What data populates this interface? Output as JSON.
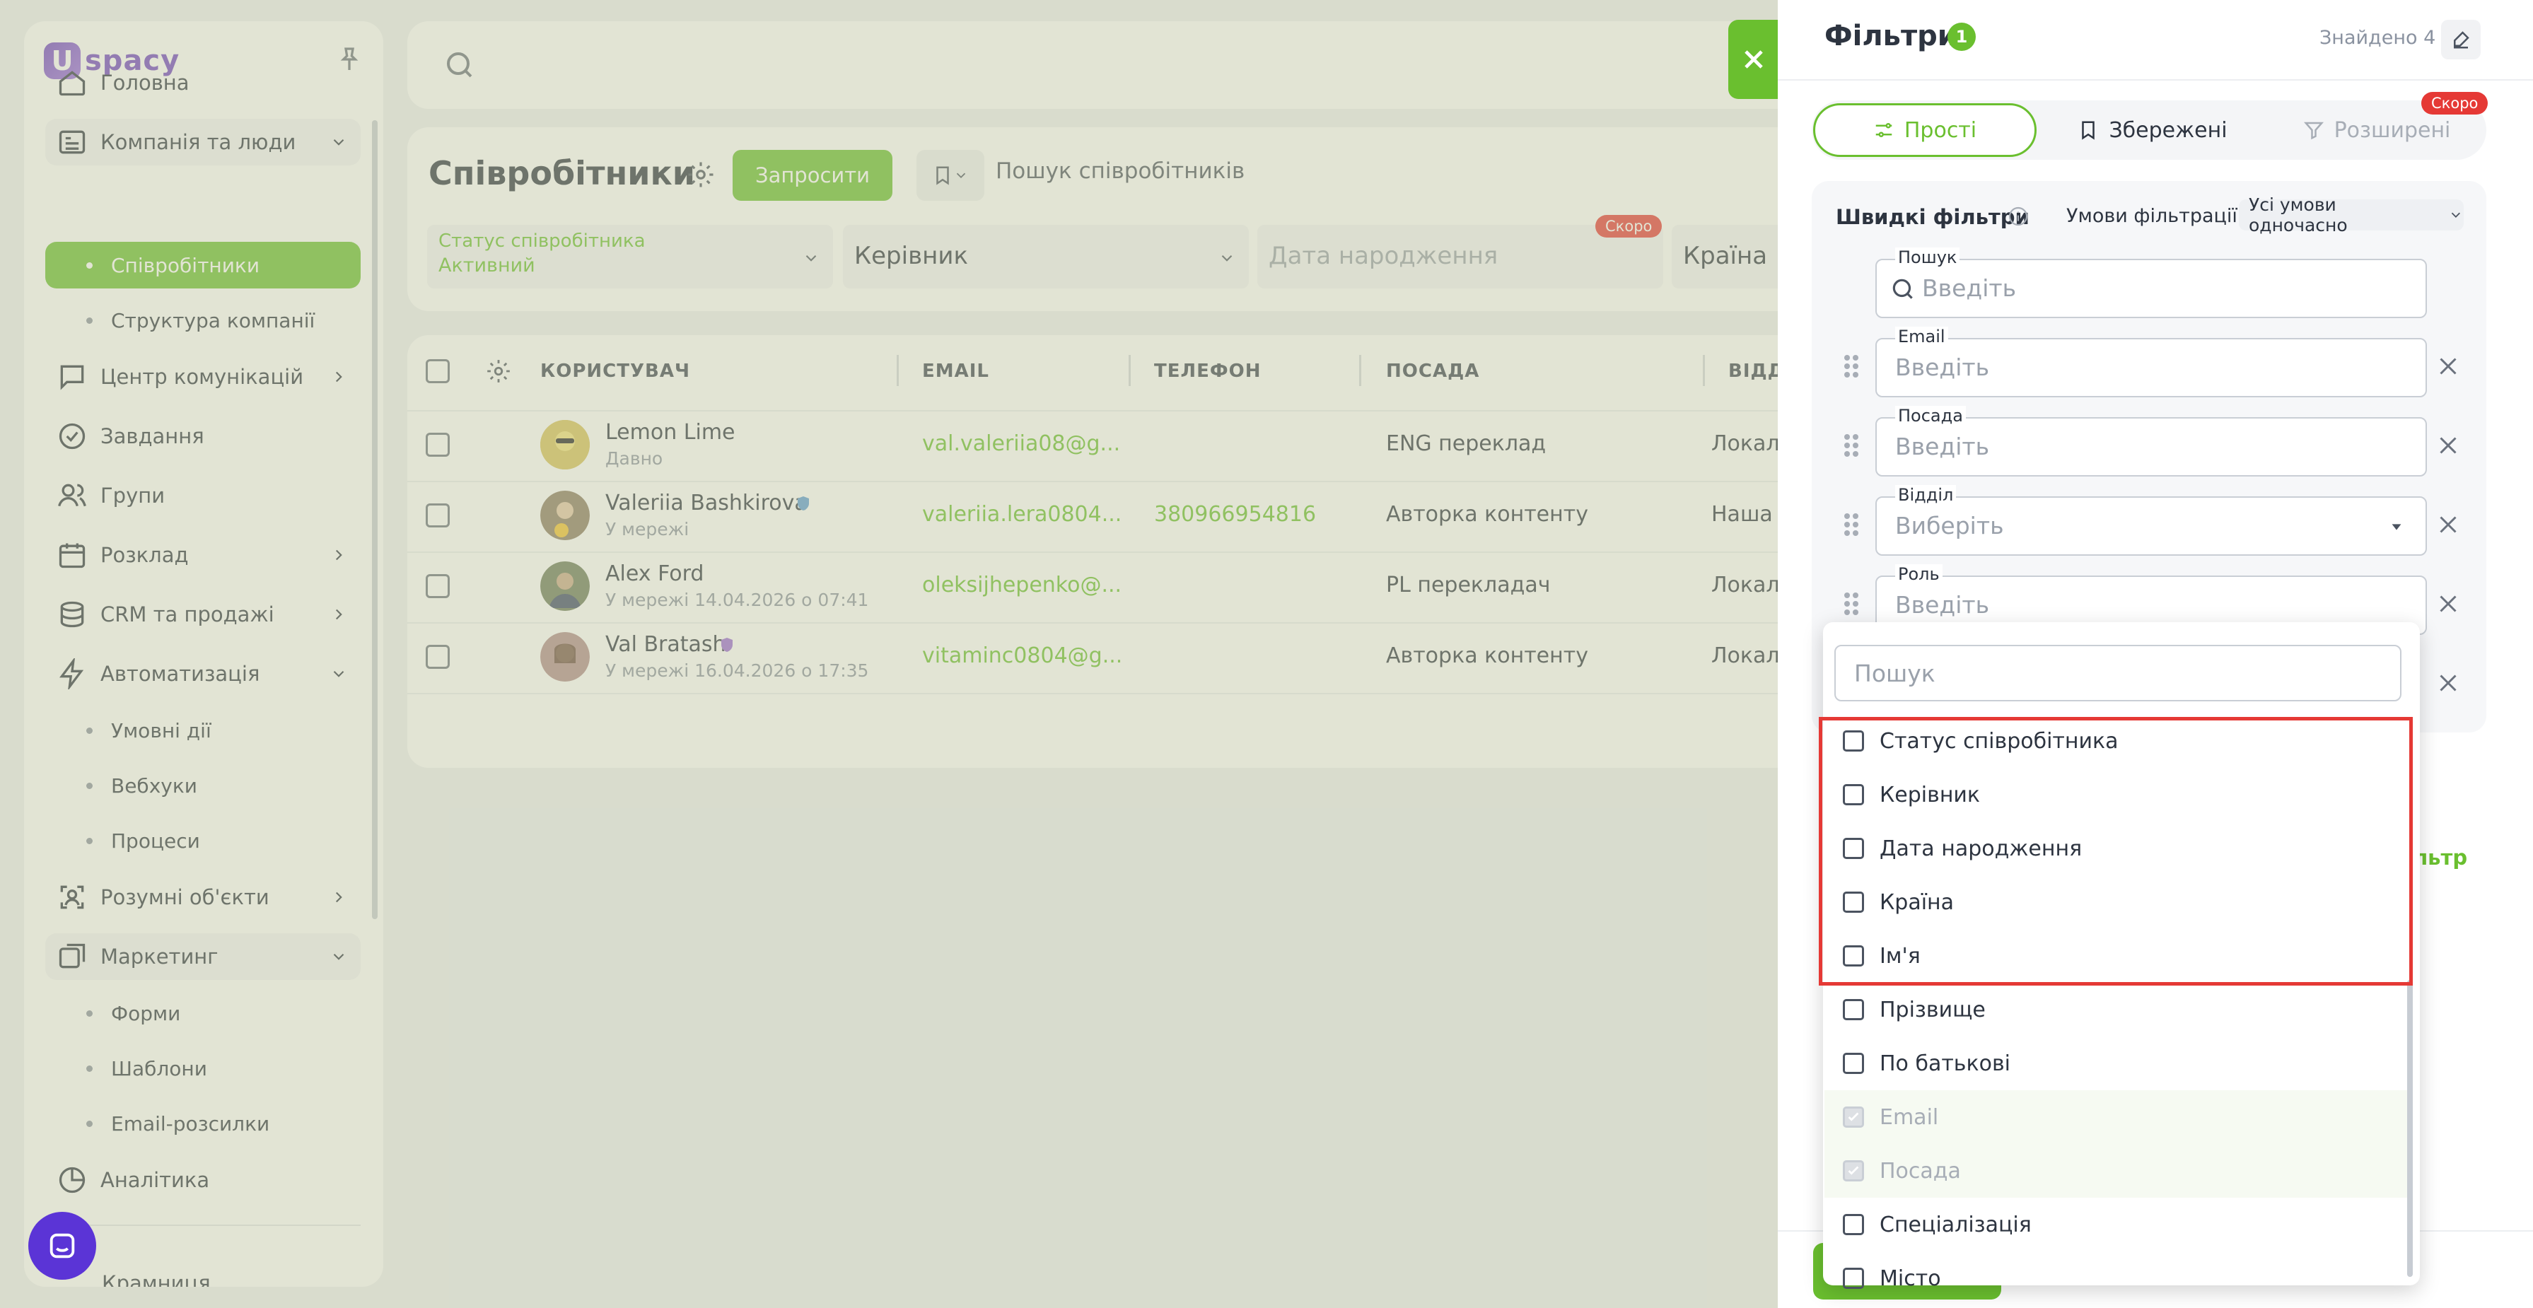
{
  "app": {
    "logo_text": "spacy",
    "logo_letter": "U"
  },
  "sidebar": {
    "items": [
      {
        "label": "Головна",
        "icon": "home-icon",
        "type": "item"
      },
      {
        "label": "Компанія та люди",
        "icon": "company-icon",
        "type": "group",
        "expanded": true
      },
      {
        "label": "Співробітники",
        "type": "sub",
        "active": true
      },
      {
        "label": "Структура компанії",
        "type": "sub"
      },
      {
        "label": "Центр комунікацій",
        "icon": "chat-icon",
        "type": "item",
        "chevron": "right"
      },
      {
        "label": "Завдання",
        "icon": "check-circle-icon",
        "type": "item"
      },
      {
        "label": "Групи",
        "icon": "users-icon",
        "type": "item"
      },
      {
        "label": "Розклад",
        "icon": "calendar-icon",
        "type": "item",
        "chevron": "right"
      },
      {
        "label": "CRM та продажі",
        "icon": "database-icon",
        "type": "item",
        "chevron": "right"
      },
      {
        "label": "Автоматизація",
        "icon": "lightning-icon",
        "type": "item",
        "chevron": "down"
      },
      {
        "label": "Умовні дії",
        "type": "sub"
      },
      {
        "label": "Вебхуки",
        "type": "sub"
      },
      {
        "label": "Процеси",
        "type": "sub"
      },
      {
        "label": "Розумні об'єкти",
        "icon": "smart-object-icon",
        "type": "item",
        "chevron": "right"
      },
      {
        "label": "Маркетинг",
        "icon": "marketing-icon",
        "type": "group",
        "chevron": "down"
      },
      {
        "label": "Форми",
        "type": "sub"
      },
      {
        "label": "Шаблони",
        "type": "sub"
      },
      {
        "label": "Email-розсилки",
        "type": "sub"
      },
      {
        "label": "Аналітика",
        "icon": "analytics-icon",
        "type": "item"
      },
      {
        "label": "Крамниця",
        "icon": "shop-icon",
        "type": "item"
      }
    ]
  },
  "main": {
    "title": "Співробітники",
    "invite_label": "Запросити",
    "search_placeholder": "Пошук співробітників",
    "filters": {
      "status_label": "Статус співробітника",
      "status_value": "Активний",
      "manager": "Керівник",
      "birth_date": "Дата народження",
      "soon": "Скоро",
      "country": "Країна"
    },
    "table": {
      "headers": [
        "КОРИСТУВАЧ",
        "EMAIL",
        "ТЕЛЕФОН",
        "ПОСАДА",
        "ВІДДІ"
      ],
      "rows": [
        {
          "name": "Lemon Lime",
          "status": "Давно",
          "email": "val.valeriia08@g...",
          "phone": "",
          "position": "ENG переклад",
          "dept": "Локаліз"
        },
        {
          "name": "Valeriia Bashkirova",
          "status": "У мережі",
          "email": "valeriia.lera0804...",
          "phone": "380966954816",
          "position": "Авторка контенту",
          "dept": "Наша к"
        },
        {
          "name": "Alex Ford",
          "status": "У мережі 14.04.2026 о 07:41",
          "email": "oleksijhepenko@...",
          "phone": "",
          "position": "PL перекладач",
          "dept": "Локаліз"
        },
        {
          "name": "Val Bratash",
          "status": "У мережі 16.04.2026 о 17:35",
          "email": "vitaminc0804@g...",
          "phone": "",
          "position": "Авторка контенту",
          "dept": "Локаліз"
        }
      ]
    }
  },
  "panel": {
    "title": "Фільтри",
    "count": "1",
    "found": "Знайдено 4",
    "tabs": [
      {
        "label": "Прості",
        "state": "active"
      },
      {
        "label": "Збережені",
        "state": "normal"
      },
      {
        "label": "Розширені",
        "state": "disabled"
      }
    ],
    "soon": "Скоро",
    "quick_title": "Швидкі фільтри",
    "cond_label": "Умови фільтрації:",
    "cond_value": "Усі умови одночасно",
    "fields": [
      {
        "label": "Пошук",
        "placeholder": "Введіть"
      },
      {
        "label": "Email",
        "placeholder": "Введіть"
      },
      {
        "label": "Посада",
        "placeholder": "Введіть"
      },
      {
        "label": "Відділ",
        "placeholder": "Виберіть"
      },
      {
        "label": "Роль",
        "placeholder": "Введіть"
      }
    ],
    "add_filter_tail": "ільтр",
    "dropdown": {
      "search_placeholder": "Пошук",
      "options": [
        {
          "label": "Статус співробітника",
          "checked": false,
          "disabled": false
        },
        {
          "label": "Керівник",
          "checked": false,
          "disabled": false
        },
        {
          "label": "Дата народження",
          "checked": false,
          "disabled": false
        },
        {
          "label": "Країна",
          "checked": false,
          "disabled": false
        },
        {
          "label": "Ім'я",
          "checked": false,
          "disabled": false
        },
        {
          "label": "Прізвище",
          "checked": false,
          "disabled": false
        },
        {
          "label": "По батькові",
          "checked": false,
          "disabled": false
        },
        {
          "label": "Email",
          "checked": true,
          "disabled": true
        },
        {
          "label": "Посада",
          "checked": true,
          "disabled": true
        },
        {
          "label": "Спеціалізація",
          "checked": false,
          "disabled": false
        },
        {
          "label": "Місто",
          "checked": false,
          "disabled": false
        }
      ]
    }
  },
  "colors": {
    "accent": "#6abf2f",
    "brand": "#6f42c1",
    "danger": "#e53935"
  }
}
